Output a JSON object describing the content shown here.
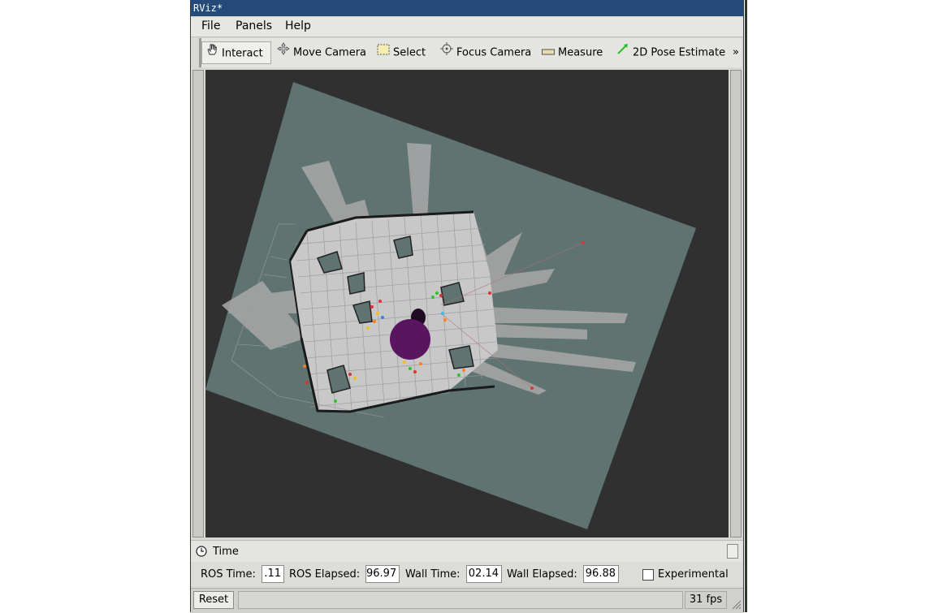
{
  "window": {
    "title": "RViz*"
  },
  "menu": {
    "items": [
      "File",
      "Panels",
      "Help"
    ]
  },
  "toolbar": {
    "tools": [
      {
        "label": "Interact",
        "icon": "hand-icon"
      },
      {
        "label": "Move Camera",
        "icon": "move-camera-icon"
      },
      {
        "label": "Select",
        "icon": "select-icon"
      },
      {
        "label": "Focus Camera",
        "icon": "focus-camera-icon"
      },
      {
        "label": "Measure",
        "icon": "measure-icon"
      },
      {
        "label": "2D Pose Estimate",
        "icon": "pose-estimate-icon"
      }
    ],
    "more": "»"
  },
  "time_panel": {
    "title": "Time",
    "ros_time_label": "ROS Time:",
    "ros_time_value": ".11",
    "ros_elapsed_label": "ROS Elapsed:",
    "ros_elapsed_value": "96.97",
    "wall_time_label": "Wall Time:",
    "wall_time_value": "02.14",
    "wall_elapsed_label": "Wall Elapsed:",
    "wall_elapsed_value": "96.88",
    "experimental_label": "Experimental",
    "experimental_checked": false
  },
  "status": {
    "reset_label": "Reset",
    "fps": "31 fps"
  },
  "colors": {
    "map_area": "#5f7370",
    "map_free": "#c8c8c8",
    "robot": "#5a1560",
    "background": "#303030"
  }
}
